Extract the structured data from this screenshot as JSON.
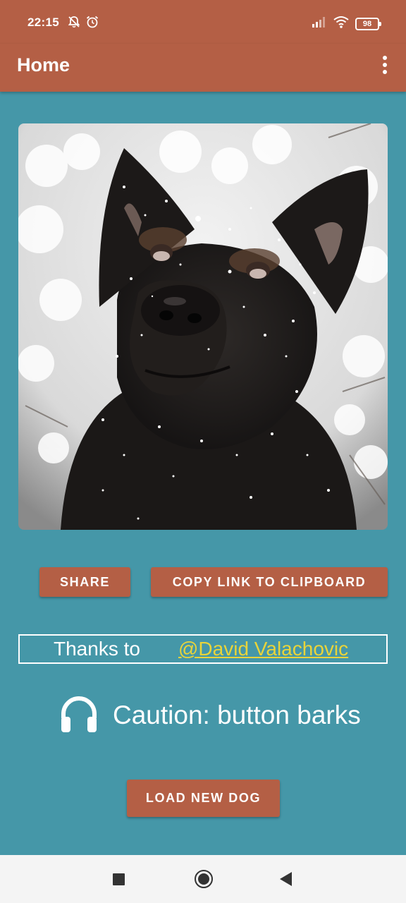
{
  "status_bar": {
    "time": "22:15",
    "battery": "98",
    "icons_left": [
      "muted-bell-icon",
      "alarm-icon"
    ],
    "icons_right": [
      "signal-icon",
      "wifi-icon",
      "battery-icon"
    ]
  },
  "app_bar": {
    "title": "Home",
    "menu_icon": "more-vert-icon"
  },
  "photo": {
    "subject": "dog-photo"
  },
  "actions": {
    "share_label": "SHARE",
    "copy_label": "COPY LINK TO CLIPBOARD",
    "load_label": "LOAD NEW DOG"
  },
  "credit": {
    "label": "Thanks to",
    "author": "@David Valachovic"
  },
  "caution": {
    "icon": "headphones-icon",
    "text": "Caution: button barks"
  },
  "colors": {
    "background": "#4597a8",
    "accent": "#b45f45",
    "link": "#e8d43a"
  }
}
